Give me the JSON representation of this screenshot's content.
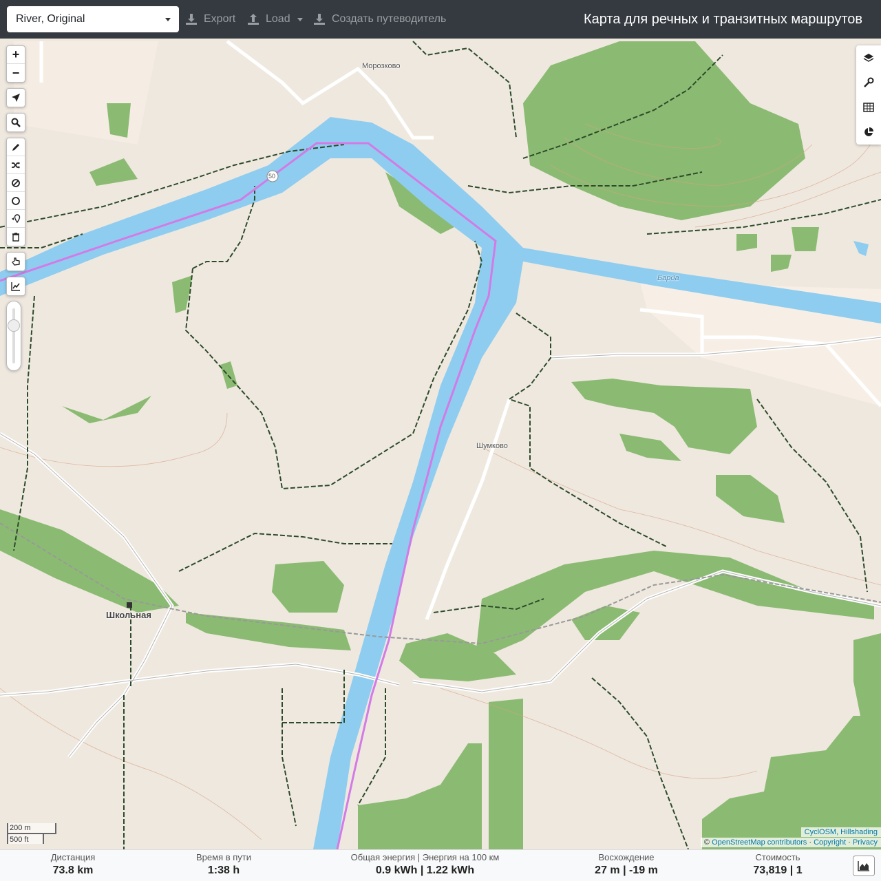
{
  "topbar": {
    "profile": "River, Original",
    "export_label": "Export",
    "load_label": "Load",
    "guide_label": "Создать путеводитель",
    "title": "Карта для речных и транзитных маршрутов"
  },
  "map": {
    "labels": {
      "village_1": "Морозково",
      "village_2": "Шумково",
      "station": "Школьная",
      "river": "Барда",
      "road_ref": "50"
    },
    "colors": {
      "water": "#8ecdf0",
      "route": "#d37ae6",
      "forest": "#8bbb72",
      "land": "#f0e8df"
    }
  },
  "scale": {
    "metric": "200 m",
    "imperial": "500 ft"
  },
  "attribution": {
    "line1": "CyclOSM, Hillshading",
    "prefix": "©",
    "osm": "OpenStreetMap contributors",
    "sep": "·",
    "copyright": "Copyright",
    "privacy": "Privacy"
  },
  "stats": {
    "distance": {
      "label": "Дистанция",
      "value": "73.8 km"
    },
    "time": {
      "label": "Время в пути",
      "value": "1:38 h"
    },
    "energy": {
      "label": "Общая энергия | Энергия на 100 км",
      "value": "0.9 kWh | 1.22 kWh"
    },
    "ascent": {
      "label": "Восхождение",
      "value": "27 m | -19 m"
    },
    "cost": {
      "label": "Стоимость",
      "value": "73,819 | 1"
    }
  }
}
